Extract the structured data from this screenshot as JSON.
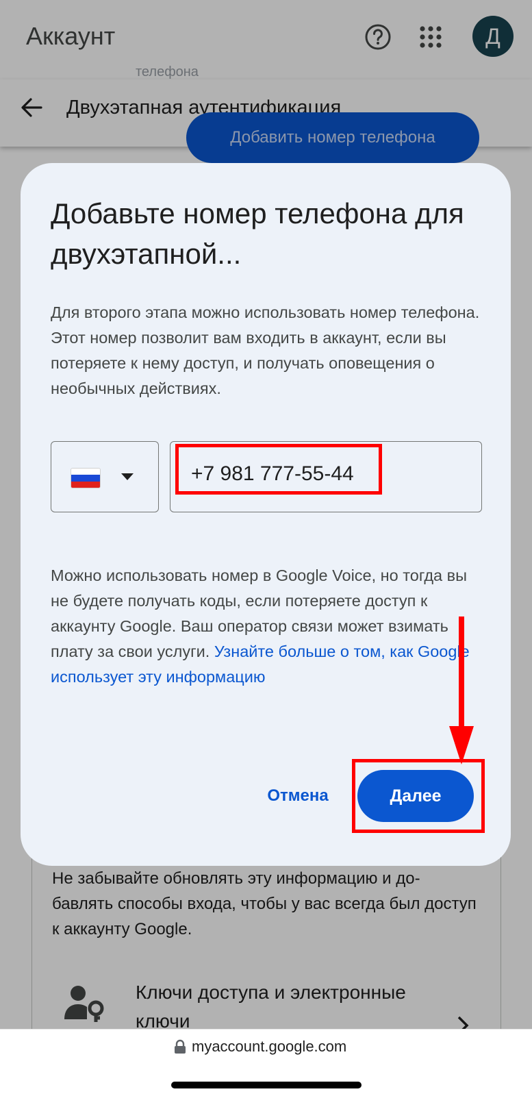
{
  "header": {
    "title": "Аккаунт",
    "avatar_letter": "Д",
    "ghost_label": "телефона"
  },
  "subheader": {
    "title": "Двухэтапная аутентификация",
    "add_phone_button": "Добавить номер телефона"
  },
  "dialog": {
    "title": "Добавьте номер телефона для двухэтапной...",
    "description": "Для второго этапа можно использовать номер телефона. Этот номер позволит вам входить в аккаунт, если вы потеряете к нему доступ, и получать оповещения о необычных действиях.",
    "country_flag": "Russia",
    "phone_value": "+7 981 777-55-44",
    "voice_note": "Можно использовать номер в Google Voice, но тогда вы не будете получать коды, если потеряете доступ к аккаунту Google. Ваш оператор связи может взимать плату за свои услуги.",
    "voice_link": "Узнайте больше о том, как Google использует эту информацию",
    "cancel_label": "Отмена",
    "next_label": "Далее"
  },
  "background": {
    "note": "Не забывайте обновлять эту информацию и до-бавлять способы входа, чтобы у вас всегда был доступ к аккаунту Google.",
    "keys_label": "Ключи доступа и электронные ключи"
  },
  "browser": {
    "url": "myaccount.google.com"
  },
  "colors": {
    "primary": "#0b57d0",
    "annotation": "#ff0000",
    "dialog_bg": "#edf2f9",
    "avatar_bg": "#17424f"
  },
  "icons": [
    "help-icon",
    "apps-icon",
    "back-arrow-icon",
    "person-key-icon",
    "chevron-right-icon",
    "lock-icon"
  ]
}
